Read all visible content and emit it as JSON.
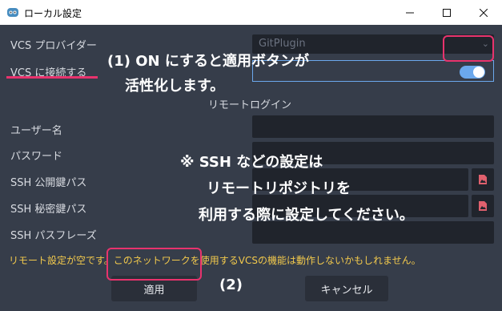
{
  "window": {
    "title": "ローカル設定",
    "icon": "godot-icon"
  },
  "form": {
    "vcs_provider_label": "VCS プロバイダー",
    "vcs_provider_value": "GitPlugin",
    "vcs_connect_label": "VCS に接続する",
    "vcs_connect_on": true,
    "remote_login_section": "リモートログイン",
    "username_label": "ユーザー名",
    "password_label": "パスワード",
    "ssh_public_label": "SSH 公開鍵パス",
    "ssh_private_label": "SSH 秘密鍵パス",
    "ssh_passphrase_label": "SSH パスフレーズ",
    "warning": "リモート設定が空です。このネットワークを使用するVCSの機能は動作しないかもしれません。"
  },
  "buttons": {
    "apply": "適用",
    "cancel": "キャンセル"
  },
  "annotations": {
    "step1_line1": "(1) ON にすると適用ボタンが",
    "step1_line2": "活性化します。",
    "ssh_line1": "※ SSH などの設定は",
    "ssh_line2": "リモートリポジトリを",
    "ssh_line3": "利用する際に設定してください。",
    "step2": "(2)"
  },
  "colors": {
    "dialog_bg": "#363d4a",
    "field_bg": "#20242c",
    "accent": "#6ba8ec",
    "warning": "#f2c94c",
    "annotation_outline": "#e8336d"
  }
}
